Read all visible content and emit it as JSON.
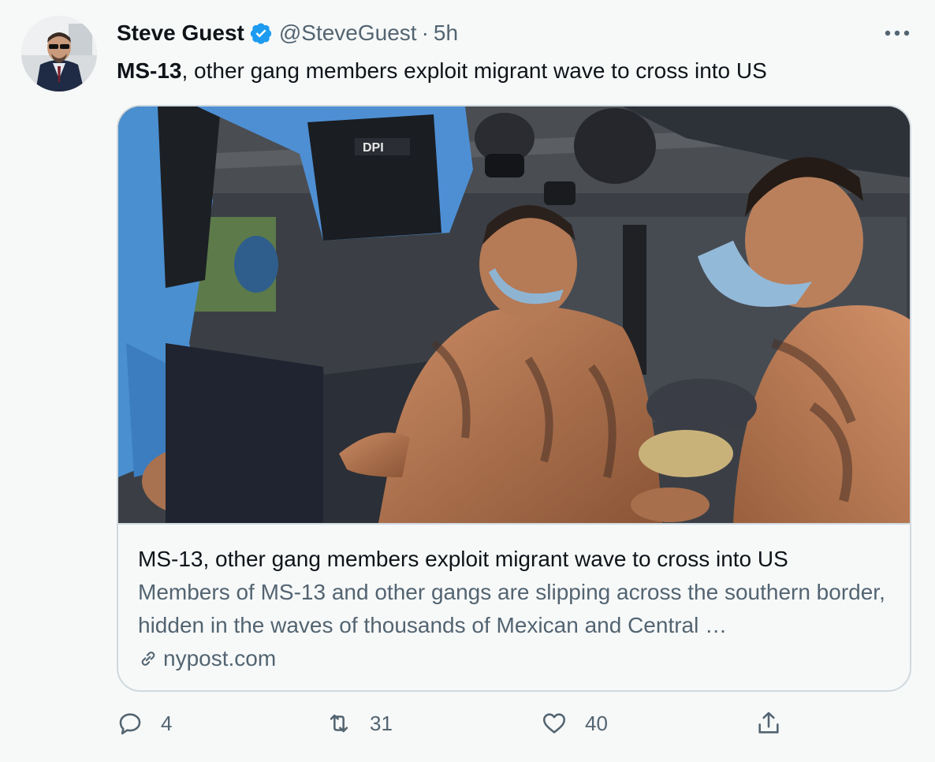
{
  "author": {
    "name": "Steve Guest",
    "handle": "@SteveGuest",
    "separator": "·",
    "time": "5h"
  },
  "tweet": {
    "text_bold": "MS-13",
    "text_rest": ", other gang members exploit migrant wave to cross into US"
  },
  "card": {
    "title": "MS-13, other gang members exploit migrant wave to cross into US",
    "description": "Members of MS-13 and other gangs are slipping across the southern border, hidden in the waves of thousands of Mexican and Central …",
    "domain": "nypost.com",
    "image_alt": "Police officers with shirtless tattooed detainees in a truck"
  },
  "actions": {
    "replies": "4",
    "retweets": "31",
    "likes": "40"
  },
  "icons": {
    "verified": "verified-badge-icon",
    "more": "more-dots-icon",
    "link": "link-icon",
    "reply": "reply-icon",
    "retweet": "retweet-icon",
    "like": "heart-icon",
    "share": "share-icon"
  },
  "colors": {
    "accent": "#1d9bf0",
    "text": "#0f1419",
    "secondary": "#536471",
    "border": "#cfd9de",
    "background": "#f7f9f9"
  }
}
